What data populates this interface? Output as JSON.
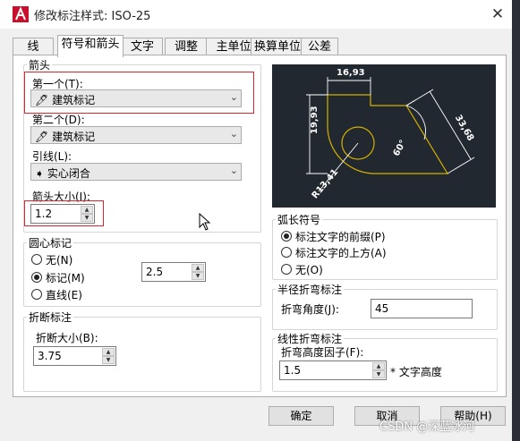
{
  "window": {
    "title": "修改标注样式: ISO-25",
    "close_glyph": "✕"
  },
  "tabs": [
    {
      "label": "线",
      "active": false
    },
    {
      "label": "符号和箭头",
      "active": true
    },
    {
      "label": "文字",
      "active": false
    },
    {
      "label": "调整",
      "active": false
    },
    {
      "label": "主单位",
      "active": false
    },
    {
      "label": "换算单位",
      "active": false
    },
    {
      "label": "公差",
      "active": false
    }
  ],
  "arrows": {
    "group_title": "箭头",
    "first_label": "第一个(T):",
    "first_value": "建筑标记",
    "second_label": "第二个(D):",
    "second_value": "建筑标记",
    "leader_label": "引线(L):",
    "leader_value": "实心闭合",
    "size_label": "箭头大小(I):",
    "size_value": "1.2"
  },
  "center_marks": {
    "group_title": "圆心标记",
    "options": [
      {
        "label": "无(N)",
        "selected": false
      },
      {
        "label": "标记(M)",
        "selected": true
      },
      {
        "label": "直线(E)",
        "selected": false
      }
    ],
    "size_value": "2.5"
  },
  "break": {
    "group_title": "折断标注",
    "size_label": "折断大小(B):",
    "size_value": "3.75"
  },
  "preview": {
    "dim_top": "16,93",
    "dim_left": "19,93",
    "dim_right": "33,68",
    "dim_radius": "R13,41",
    "dim_angle": "60°",
    "colors": {
      "background": "#212830",
      "geometry": "#d4b000",
      "dimension": "#ffffff"
    }
  },
  "arc_length": {
    "group_title": "弧长符号",
    "options": [
      {
        "label": "标注文字的前缀(P)",
        "selected": true
      },
      {
        "label": "标注文字的上方(A)",
        "selected": false
      },
      {
        "label": "无(O)",
        "selected": false
      }
    ]
  },
  "radius_jog": {
    "group_title": "半径折弯标注",
    "angle_label": "折弯角度(J):",
    "angle_value": "45"
  },
  "linear_jog": {
    "group_title": "线性折弯标注",
    "factor_label": "折弯高度因子(F):",
    "factor_value": "1.5",
    "suffix": "* 文字高度"
  },
  "buttons": {
    "ok": "确定",
    "cancel": "取消",
    "help": "帮助(H)"
  },
  "watermark": "CSDN @深蓝冰河",
  "icons": {
    "pen": "pen-icon",
    "arrow": "closed-arrow-icon",
    "dropdown": "chevron-down-icon"
  }
}
